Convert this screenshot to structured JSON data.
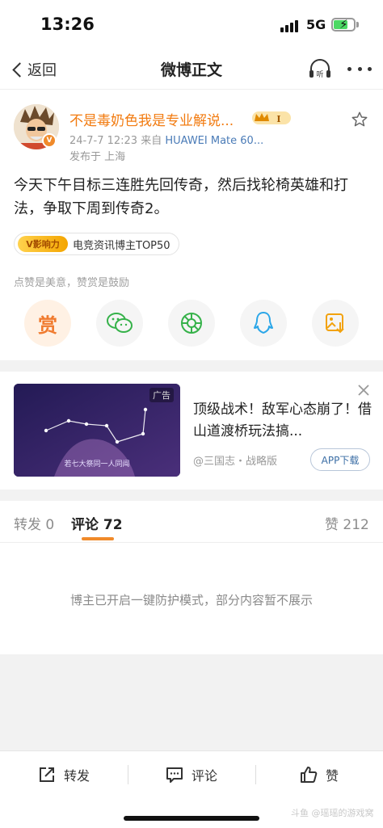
{
  "status_bar": {
    "time": "13:26",
    "network": "5G",
    "battery_percent": 70
  },
  "nav": {
    "back_label": "返回",
    "title": "微博正文",
    "listen_icon_label": "听"
  },
  "post": {
    "username": "不是毒奶色我是专业解说...",
    "verified_mark": "V",
    "vip_level": "I",
    "date": "24-7-7 12:23",
    "source_prefix": "来自",
    "source": "HUAWEI Mate 60...",
    "location": "发布于 上海",
    "text": "今天下午目标三连胜先回传奇，然后找轮椅英雄和打法，争取下周到传奇2。",
    "influence_logo": "V影响力",
    "influence_tag": "电竞资讯博主TOP50",
    "like_hint": "点赞是美意，赞赏是鼓励",
    "reward_glyph": "赏",
    "share_targets": [
      "reward-icon",
      "wechat-icon",
      "moments-icon",
      "qq-icon",
      "save-image-icon"
    ]
  },
  "ad": {
    "tag": "广告",
    "image_caption": "若七大祭同一人同闻",
    "title": "顶级战术！敌军心态崩了！借山道渡桥玩法搞...",
    "source": "@三国志・战略版",
    "button": "APP下载"
  },
  "tabs": [
    {
      "label": "转发",
      "count": "0"
    },
    {
      "label": "评论",
      "count": "72"
    },
    {
      "label": "赞",
      "count": "212"
    }
  ],
  "comments": {
    "note": "博主已开启一键防护模式，部分内容暂不展示"
  },
  "bottom_bar": {
    "repost": "转发",
    "comment": "评论",
    "like": "赞",
    "watermark": "斗鱼 @瑶瑶的游戏窝"
  },
  "colors": {
    "accent": "#f08a2a",
    "username": "#f27b10",
    "link": "#4a7bb7"
  }
}
